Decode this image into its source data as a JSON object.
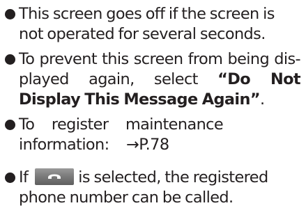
{
  "bullets": [
    {
      "text": "This screen goes off if the screen is not operated for several seconds."
    },
    {
      "text_before": "To prevent this screen from being dis-played again, select ",
      "emphasis": "“Do Not Display This Message Again”",
      "text_after": "."
    },
    {
      "text": "To register maintenance information: →P.78"
    },
    {
      "text_before": "If",
      "text_after": "is selected, the registered phone number can be called.",
      "icon": "phone-handset-icon"
    }
  ],
  "colors": {
    "text": "#231f20",
    "button_top": "#9a9a9a",
    "button_bottom": "#5f5f5f",
    "icon": "#ffffff"
  }
}
